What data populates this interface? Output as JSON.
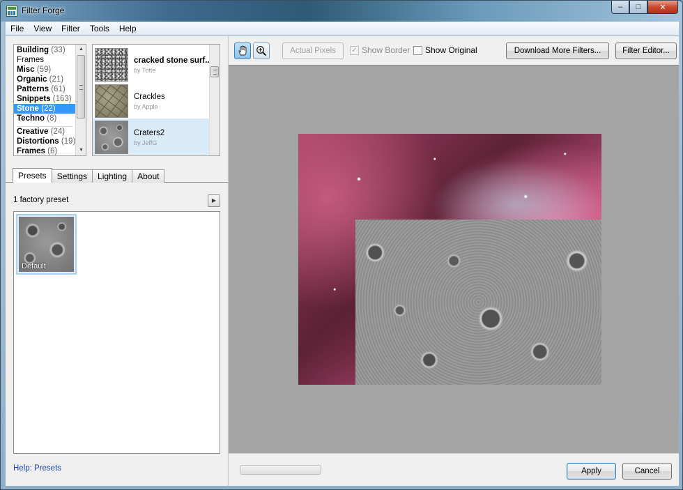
{
  "window": {
    "title": "Filter Forge",
    "minimize": "–",
    "maximize": "□",
    "close": "✕"
  },
  "menu": [
    "File",
    "View",
    "Filter",
    "Tools",
    "Help"
  ],
  "categories": [
    {
      "name": "Building",
      "count": "(33)",
      "bold": true,
      "selected": false
    },
    {
      "name": "Frames",
      "count": "",
      "bold": false,
      "selected": false
    },
    {
      "name": "Misc",
      "count": "(59)",
      "bold": true,
      "selected": false
    },
    {
      "name": "Organic",
      "count": "(21)",
      "bold": true,
      "selected": false
    },
    {
      "name": "Patterns",
      "count": "(61)",
      "bold": true,
      "selected": false
    },
    {
      "name": "Snippets",
      "count": "(163)",
      "bold": true,
      "selected": false
    },
    {
      "name": "Stone",
      "count": "(22)",
      "bold": true,
      "selected": true
    },
    {
      "name": "Techno",
      "count": "(8)",
      "bold": true,
      "selected": false
    },
    {
      "name": "Creative",
      "count": "(24)",
      "bold": true,
      "selected": false,
      "separator_before": true
    },
    {
      "name": "Distortions",
      "count": "(19)",
      "bold": true,
      "selected": false
    },
    {
      "name": "Frames",
      "count": "(6)",
      "bold": true,
      "selected": false
    }
  ],
  "filters": [
    {
      "name": "cracked stone surf...",
      "author": "by Totte",
      "bold": true,
      "selected": false,
      "thumb": "cracked-stone"
    },
    {
      "name": "Crackles",
      "author": "by Apple",
      "bold": false,
      "selected": false,
      "thumb": "crackles"
    },
    {
      "name": "Craters2",
      "author": "by JeffG",
      "bold": false,
      "selected": true,
      "thumb": "craters"
    }
  ],
  "tabs": [
    {
      "label": "Presets",
      "active": true
    },
    {
      "label": "Settings",
      "active": false
    },
    {
      "label": "Lighting",
      "active": false
    },
    {
      "label": "About",
      "active": false
    }
  ],
  "presets": {
    "count_label": "1 factory preset",
    "items": [
      {
        "label": "Default",
        "selected": true
      }
    ]
  },
  "help_link": "Help: Presets",
  "toolbar": {
    "hand_tool": "hand-icon",
    "zoom_tool": "zoom-in-icon",
    "actual_pixels": "Actual Pixels",
    "show_border": {
      "label": "Show Border",
      "checked": true,
      "enabled": false
    },
    "show_original": {
      "label": "Show Original",
      "checked": false,
      "enabled": true
    },
    "download_more": "Download More Filters...",
    "filter_editor": "Filter Editor..."
  },
  "progress": {
    "value": 0
  },
  "buttons": {
    "apply": "Apply",
    "cancel": "Cancel"
  },
  "colors": {
    "selection": "#3399ff",
    "accent_border": "#3c7fb1",
    "viewport_bg": "#a4a4a4"
  }
}
